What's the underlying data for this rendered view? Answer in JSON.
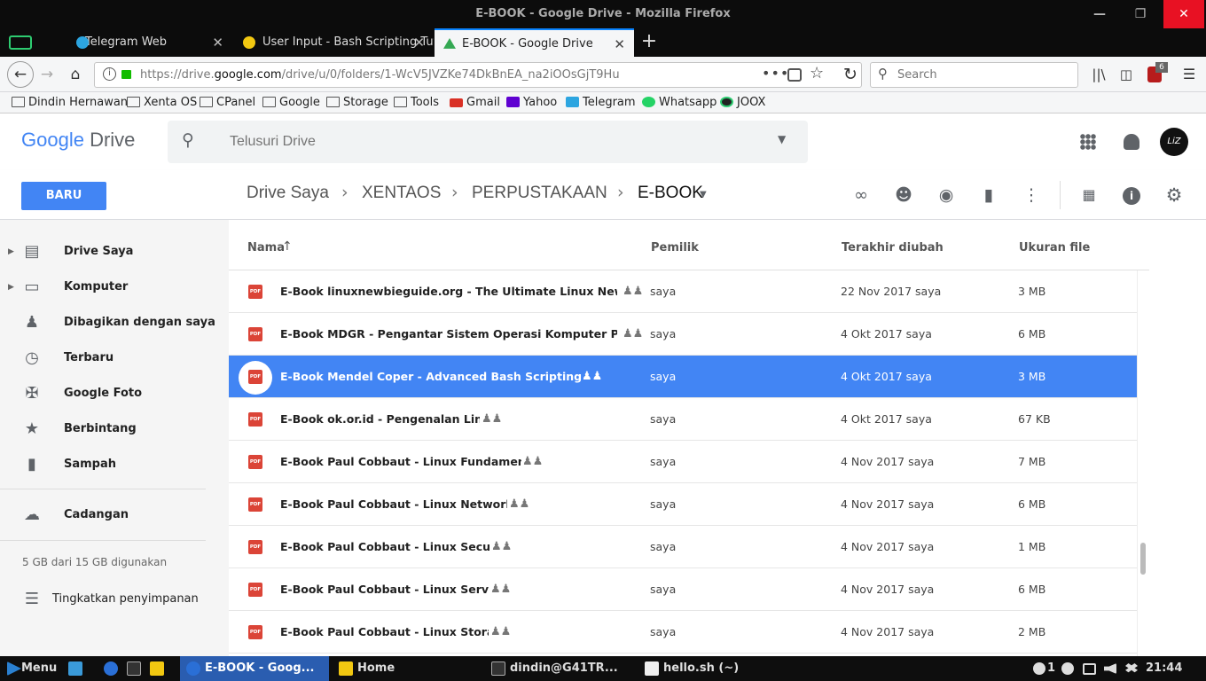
{
  "window": {
    "title": "E-BOOK - Google Drive - Mozilla Firefox"
  },
  "tabs": [
    {
      "label": "Telegram Web",
      "icon": "telegram-icon",
      "color": "#2ca5e0"
    },
    {
      "label": "User Input - Bash Scripting Tutorial",
      "icon": "circle-icon",
      "color": "#f2c811"
    },
    {
      "label": "E-BOOK - Google Drive",
      "icon": "google-drive-icon",
      "color": "#34a853"
    }
  ],
  "nav": {
    "url_prefix": "https://drive.",
    "url_domain": "google.com",
    "url_path": "/drive/u/0/folders/1-WcV5JVZKe74DkBnEA_na2iOOsGjT9Hu",
    "search_placeholder": "Search",
    "badge": "6"
  },
  "bookmarks": [
    {
      "label": "Dindin Hernawan",
      "type": "folder"
    },
    {
      "label": "Xenta OS",
      "type": "folder"
    },
    {
      "label": "CPanel",
      "type": "folder"
    },
    {
      "label": "Google",
      "type": "folder"
    },
    {
      "label": "Storage",
      "type": "folder"
    },
    {
      "label": "Tools",
      "type": "folder"
    },
    {
      "label": "Gmail",
      "type": "site",
      "color": "#d93025"
    },
    {
      "label": "Yahoo",
      "type": "site",
      "color": "#5f01d1"
    },
    {
      "label": "Telegram",
      "type": "site",
      "color": "#2ca5e0"
    },
    {
      "label": "Whatsapp",
      "type": "site",
      "color": "#25d366"
    },
    {
      "label": "JOOX",
      "type": "site",
      "color": "#222"
    }
  ],
  "drive": {
    "logo_google": "Google",
    "logo_drive": "Drive",
    "search_placeholder": "Telusuri Drive",
    "new_button": "BARU",
    "breadcrumbs": [
      "Drive Saya",
      "XENTAOS",
      "PERPUSTAKAAN",
      "E-BOOK"
    ],
    "avatar_text": "LiZ"
  },
  "sidebar": {
    "items": [
      {
        "label": "Drive Saya",
        "icon": "drive-icon",
        "expandable": true
      },
      {
        "label": "Komputer",
        "icon": "computer-icon",
        "expandable": true
      },
      {
        "label": "Dibagikan dengan saya",
        "icon": "people-icon",
        "expandable": false
      },
      {
        "label": "Terbaru",
        "icon": "clock-icon",
        "expandable": false
      },
      {
        "label": "Google Foto",
        "icon": "pinwheel-icon",
        "expandable": false
      },
      {
        "label": "Berbintang",
        "icon": "star-icon",
        "expandable": false
      },
      {
        "label": "Sampah",
        "icon": "trash-icon",
        "expandable": false
      }
    ],
    "backup": "Cadangan",
    "storage_text": "5 GB dari 15 GB digunakan",
    "upgrade": "Tingkatkan penyimpanan"
  },
  "columns": {
    "name": "Nama",
    "owner": "Pemilik",
    "modified": "Terakhir diubah",
    "size": "Ukuran file"
  },
  "files": [
    {
      "name": "E-Book linuxnewbieguide.org - The Ultimate Linux Newbie Guide ...",
      "owner": "saya",
      "modified": "22 Nov 2017  saya",
      "size": "3 MB",
      "selected": false
    },
    {
      "name": "E-Book MDGR - Pengantar Sistem Operasi Komputer Plus Ilustra...",
      "owner": "saya",
      "modified": "4 Okt 2017  saya",
      "size": "6 MB",
      "selected": false
    },
    {
      "name": "E-Book Mendel Coper - Advanced Bash Scripting Guide.pdf",
      "owner": "saya",
      "modified": "4 Okt 2017  saya",
      "size": "3 MB",
      "selected": true
    },
    {
      "name": "E-Book ok.or.id - Pengenalan Linux.pdf",
      "owner": "saya",
      "modified": "4 Okt 2017  saya",
      "size": "67 KB",
      "selected": false
    },
    {
      "name": "E-Book Paul Cobbaut - Linux Fundamentals.pdf",
      "owner": "saya",
      "modified": "4 Nov 2017  saya",
      "size": "7 MB",
      "selected": false
    },
    {
      "name": "E-Book Paul Cobbaut - Linux Networking.pdf",
      "owner": "saya",
      "modified": "4 Nov 2017  saya",
      "size": "6 MB",
      "selected": false
    },
    {
      "name": "E-Book Paul Cobbaut - Linux Security.pdf",
      "owner": "saya",
      "modified": "4 Nov 2017  saya",
      "size": "1 MB",
      "selected": false
    },
    {
      "name": "E-Book Paul Cobbaut - Linux Servers.pdf",
      "owner": "saya",
      "modified": "4 Nov 2017  saya",
      "size": "6 MB",
      "selected": false
    },
    {
      "name": "E-Book Paul Cobbaut - Linux Storage.pdf",
      "owner": "saya",
      "modified": "4 Nov 2017  saya",
      "size": "2 MB",
      "selected": false
    }
  ],
  "pdf_label": "PDF",
  "taskbar": {
    "menu": "Menu",
    "windows": [
      {
        "label": "E-BOOK - Goog...",
        "active": true
      },
      {
        "label": "Home",
        "active": false
      },
      {
        "label": "dindin@G41TR...",
        "active": false
      },
      {
        "label": "hello.sh (~)",
        "active": false
      }
    ],
    "notif_count": "1",
    "clock": "21:44"
  },
  "colors": {
    "accent": "#4285f4",
    "selected_row": "#4285f4",
    "pdf_red": "#db4437"
  }
}
